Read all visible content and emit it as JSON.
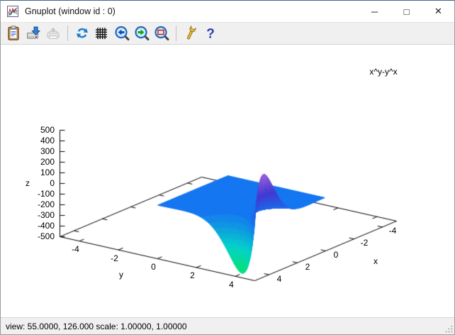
{
  "window": {
    "title": "Gnuplot (window id : 0)",
    "app_icon": "gnuplot-icon",
    "controls": [
      {
        "name": "minimize",
        "glyph": "─"
      },
      {
        "name": "maximize",
        "glyph": "□"
      },
      {
        "name": "close",
        "glyph": "✕"
      }
    ]
  },
  "toolbar": {
    "items": [
      {
        "type": "button",
        "icon": "copy-clipboard-icon"
      },
      {
        "type": "button",
        "icon": "save-file-icon"
      },
      {
        "type": "button",
        "icon": "print-icon",
        "disabled": true
      },
      {
        "type": "separator"
      },
      {
        "type": "button",
        "icon": "replot-icon"
      },
      {
        "type": "button",
        "icon": "grid-icon"
      },
      {
        "type": "button",
        "icon": "zoom-previous-icon"
      },
      {
        "type": "button",
        "icon": "zoom-next-icon"
      },
      {
        "type": "button",
        "icon": "unzoom-icon"
      },
      {
        "type": "separator"
      },
      {
        "type": "button",
        "icon": "options-wrench-icon"
      },
      {
        "type": "button",
        "icon": "help-icon"
      }
    ]
  },
  "chart_data": {
    "type": "surface3d",
    "title": "x^y-y^x",
    "expression": "x**y - y**x",
    "xlabel": "x",
    "ylabel": "y",
    "zlabel": "z",
    "xrange": [
      -5,
      5
    ],
    "yrange": [
      -5,
      5
    ],
    "zrange": [
      -500,
      500
    ],
    "xtick_values": [
      -4,
      -2,
      0,
      2,
      4
    ],
    "ytick_values": [
      -4,
      -2,
      0,
      2,
      4
    ],
    "ztick_values": [
      -500,
      -400,
      -300,
      -200,
      -100,
      0,
      100,
      200,
      300,
      400,
      500
    ],
    "surface_domain_x": [
      0.04,
      5
    ],
    "surface_domain_y": [
      0.04,
      5
    ],
    "grid_samples": 130,
    "legend_position": "top-right",
    "grid": false,
    "view_rot_x": 55.0,
    "view_rot_z": 126.0,
    "palette": [
      {
        "z": -500,
        "color": "#00e564"
      },
      {
        "z": -250,
        "color": "#00d2c8"
      },
      {
        "z": 0,
        "color": "#1577f0"
      },
      {
        "z": 250,
        "color": "#4338d2"
      },
      {
        "z": 500,
        "color": "#a765da"
      }
    ],
    "palette_band_size": 40
  },
  "statusbar": {
    "text": "view: 55.0000, 126.000  scale: 1.00000, 1.00000"
  }
}
